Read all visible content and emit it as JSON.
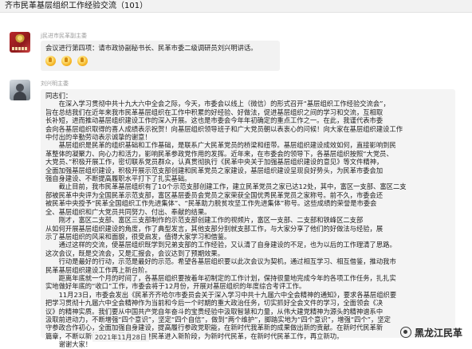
{
  "header": {
    "title": "齐市民革基层组织工作经验交流（101）"
  },
  "messages": [
    {
      "sender": "j民进市民革副主委",
      "text": "会议进行第四项：请市政协副秘书长、民革市委二级调研员刘兴明讲话。",
      "emoji": [
        "thumbs-up",
        "thumbs-up",
        "thumbs-up"
      ]
    },
    {
      "sender": "刘兴明主委",
      "paragraphs": [
        "同志们：",
        "　　在深入学习贯彻中共十九大六中全会之际，今天，市委会以线上（微信）的形式召开“基层组织工作经验交流会”，",
        "旨在总结我们在近年来我市民革基层组织在工作中积累的好经验、好做法，促进基层组织之间的学习和交流，互相取",
        "长补短，进而推动基层组织建设工作的深入开展。这也是市委会今年年初确定的重点工作之一。在此，我谨代表市委",
        "会向各基层组织取得的喜人成绩表示祝贺！向基层组织领导班子和广大党员朝以表衷心的问候！向大家在基层组织建设工作",
        "中付出的辛勤劳动表示诚挚的谢意！",
        "　　基层组织是民革的组织基础和工作基础，是联系广大民革党员的桥梁和纽带。基层组织建设成效如何，直接影响到民",
        "革整体的凝聚力、向心力和活力，影响民革参政党作用的发挥。近年来，在市委会的领导下，各基层组织按照“大党员、",
        "大党员、”积极开展工作，密切联系党员群众，认真贯彻执行《民革中央关于加强基层组织建设的意见》等文件精神，",
        "全面加强基层组织建设，积极开展示范支部创建和民革党员之家建设，基层组织建设呈现良好势头，为民革市委会加",
        "强自身建设、不断提高履职水平打下了扎实基础。",
        "　　截止目前，我市民革基层组织有了10个示范支部创建工作，建立民革党员之家已达12处，其中，富区一支部、富区二支",
        "部被民革中央评为全国民革示范支部，富区基层委员会党员之家荣获全国优秀民革党员之家称号。前不久，市委会还",
        "被民革中央授予“民革全国组织工作先进集体”、“民革助力脱贫攻坚工作先进集体”称号。这些成绩的荣誉是市委会",
        "全、基层组织和广大党员共同努力、付出、奉献的结果。",
        "　　刚才，富区二支部、富区三支部制作的示范支部创建工作的视频片，富区一支部、二支部和铁峰区二支部",
        "从如何开展基层组织建设的角度，作了典型发言，其他支部分别就支部工作，与大家分享了他们的好做法与经验，展",
        "示了基层组织的风采和面貌，很受启发，值得大家学习和借鉴。",
        "　　通过这样的交流，使基层组织既学到兄弟支部的工作经验，又认清了自身建设的不足，也为以后的工作理清了思路。",
        "这次会议，既是交流会，又是汇报会，会议达到了预期效果。",
        "　　行动是最好的行动，示范是最好的示范。希望各基层组织要以此次会议为契机，通过相互学习、相互借鉴，推动我市",
        "民革基层组织建设工作再上新台阶。",
        "　　距离年底就一个月的时间了，各基层组织要按着年初制定的工作计划，保持很量地完成今年的各项工作任务，扎扎实",
        "实地做好年底的“收口”工作，市委会将于12月份，开展对基层组织的年度综合考评工作。",
        "　　11月23日，市委会发出《民革齐齐哈尔市委员会关于深入学习中共十九届六中全会精神的通知》，要求各基层组织要",
        "把学习贯彻十九届六中全会精神作为当前和今后一个时期的重大政治任务，切实抓好全会文件的学习，全面领会《决",
        "议》的精神实质。我们要从中国共产党自年奋斗的宝贵经验中汲取智慧和力量，从伟大建党精神为源头的精神谱系中",
        "汲取前进动力，不断增强“四个意识”，坚定“四个自信”，做到“两个维护”，脚踏实地为“四个意识”，增强“四个”，坚定",
        "守参政合作初心，全面加强自身建设，提高履行参政党职能，在新时代我革新的成果做出新的贡献。在新时代民革新",
        "篇章，不断以新的业绩回报全面推进民革进入新阶段，为新时代民革，在新时代民革工作，再立新功。",
        "　　谢谢大家！"
      ],
      "date": "2021年11月28日"
    }
  ],
  "watermark": {
    "label": "黑龙江民革",
    "icon": "wechat-channel-icon"
  }
}
